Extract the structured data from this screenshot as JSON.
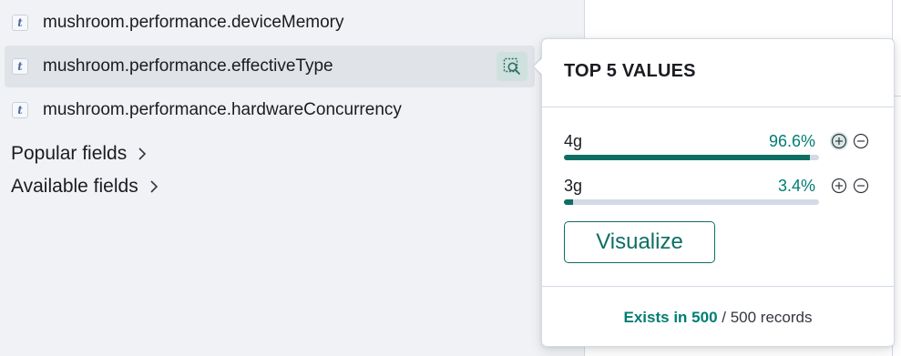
{
  "sidebar": {
    "fields": [
      {
        "type": "t",
        "name": "mushroom.performance.deviceMemory"
      },
      {
        "type": "t",
        "name": "mushroom.performance.effectiveType"
      },
      {
        "type": "t",
        "name": "mushroom.performance.hardwareConcurrency"
      }
    ],
    "sections": [
      {
        "label": "Popular fields"
      },
      {
        "label": "Available fields"
      }
    ]
  },
  "popover": {
    "title": "TOP 5 VALUES",
    "values": [
      {
        "label": "4g",
        "percent_text": "96.6%",
        "percent": 96.6
      },
      {
        "label": "3g",
        "percent_text": "3.4%",
        "percent": 3.4
      }
    ],
    "visualize_label": "Visualize",
    "footer": {
      "exists_label": "Exists in 500",
      "rest": " / 500 records"
    }
  },
  "colors": {
    "accent": "#0f6e63",
    "accent_text": "#017d73",
    "sidebar_bg": "#f0f2f5",
    "active_row_bg": "#e0e3e8",
    "bar_track": "#d3dae6"
  },
  "icons": {
    "field_type": "string-type-icon",
    "details": "inspect-details-icon",
    "chevron": "chevron-right-icon",
    "filter_for": "plus-in-circle-icon",
    "filter_out": "minus-in-circle-icon"
  }
}
